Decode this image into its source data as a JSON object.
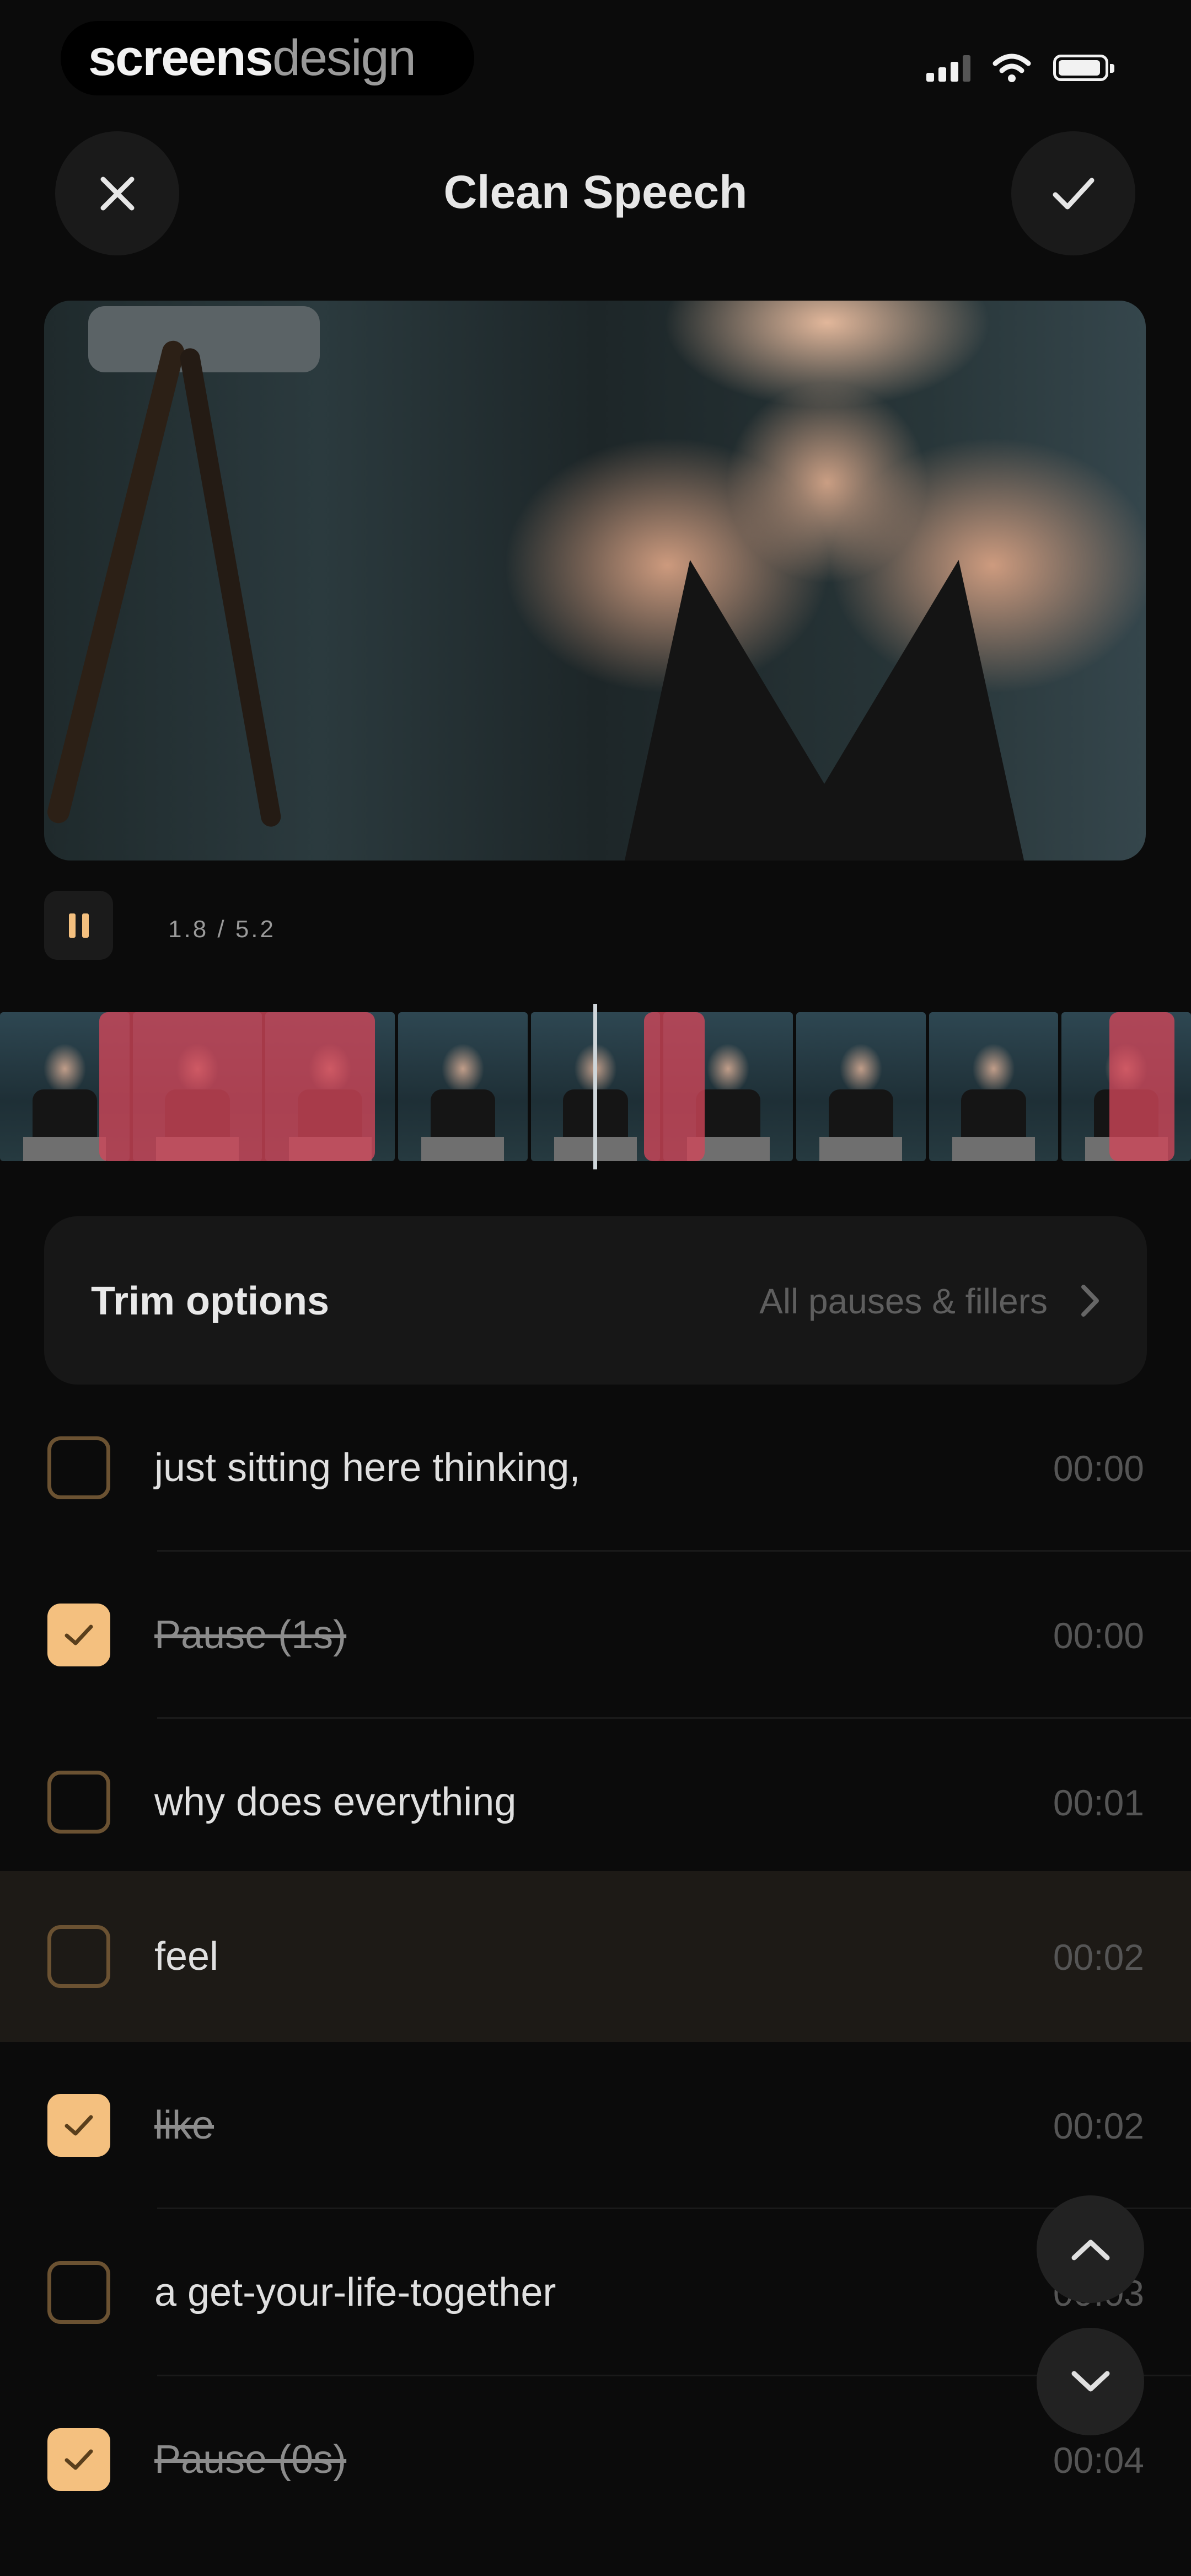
{
  "status_bar": {
    "brand_part1": "screens",
    "brand_part2": "design"
  },
  "header": {
    "title": "Clean Speech",
    "close_icon": "close-icon",
    "done_icon": "checkmark-icon"
  },
  "player": {
    "time": "1.8 / 5.2",
    "pause_icon": "pause-icon"
  },
  "trim_options": {
    "label": "Trim options",
    "value": "All pauses & fillers",
    "icon": "chevron-right-icon"
  },
  "transcript": [
    {
      "text": "just sitting here thinking,",
      "time": "00:00",
      "checked": false
    },
    {
      "text": "Pause (1s)",
      "time": "00:00",
      "checked": true
    },
    {
      "text": "why does everything",
      "time": "00:01",
      "checked": false
    },
    {
      "text": "feel",
      "time": "00:02",
      "checked": false
    },
    {
      "text": "like",
      "time": "00:02",
      "checked": true
    },
    {
      "text": "a get-your-life-together",
      "time": "00:03",
      "checked": false
    },
    {
      "text": "Pause (0s)",
      "time": "00:04",
      "checked": true
    }
  ],
  "colors": {
    "accent": "#f4c07f",
    "cut_overlay": "#d2465a",
    "background": "#0b0b0b"
  }
}
